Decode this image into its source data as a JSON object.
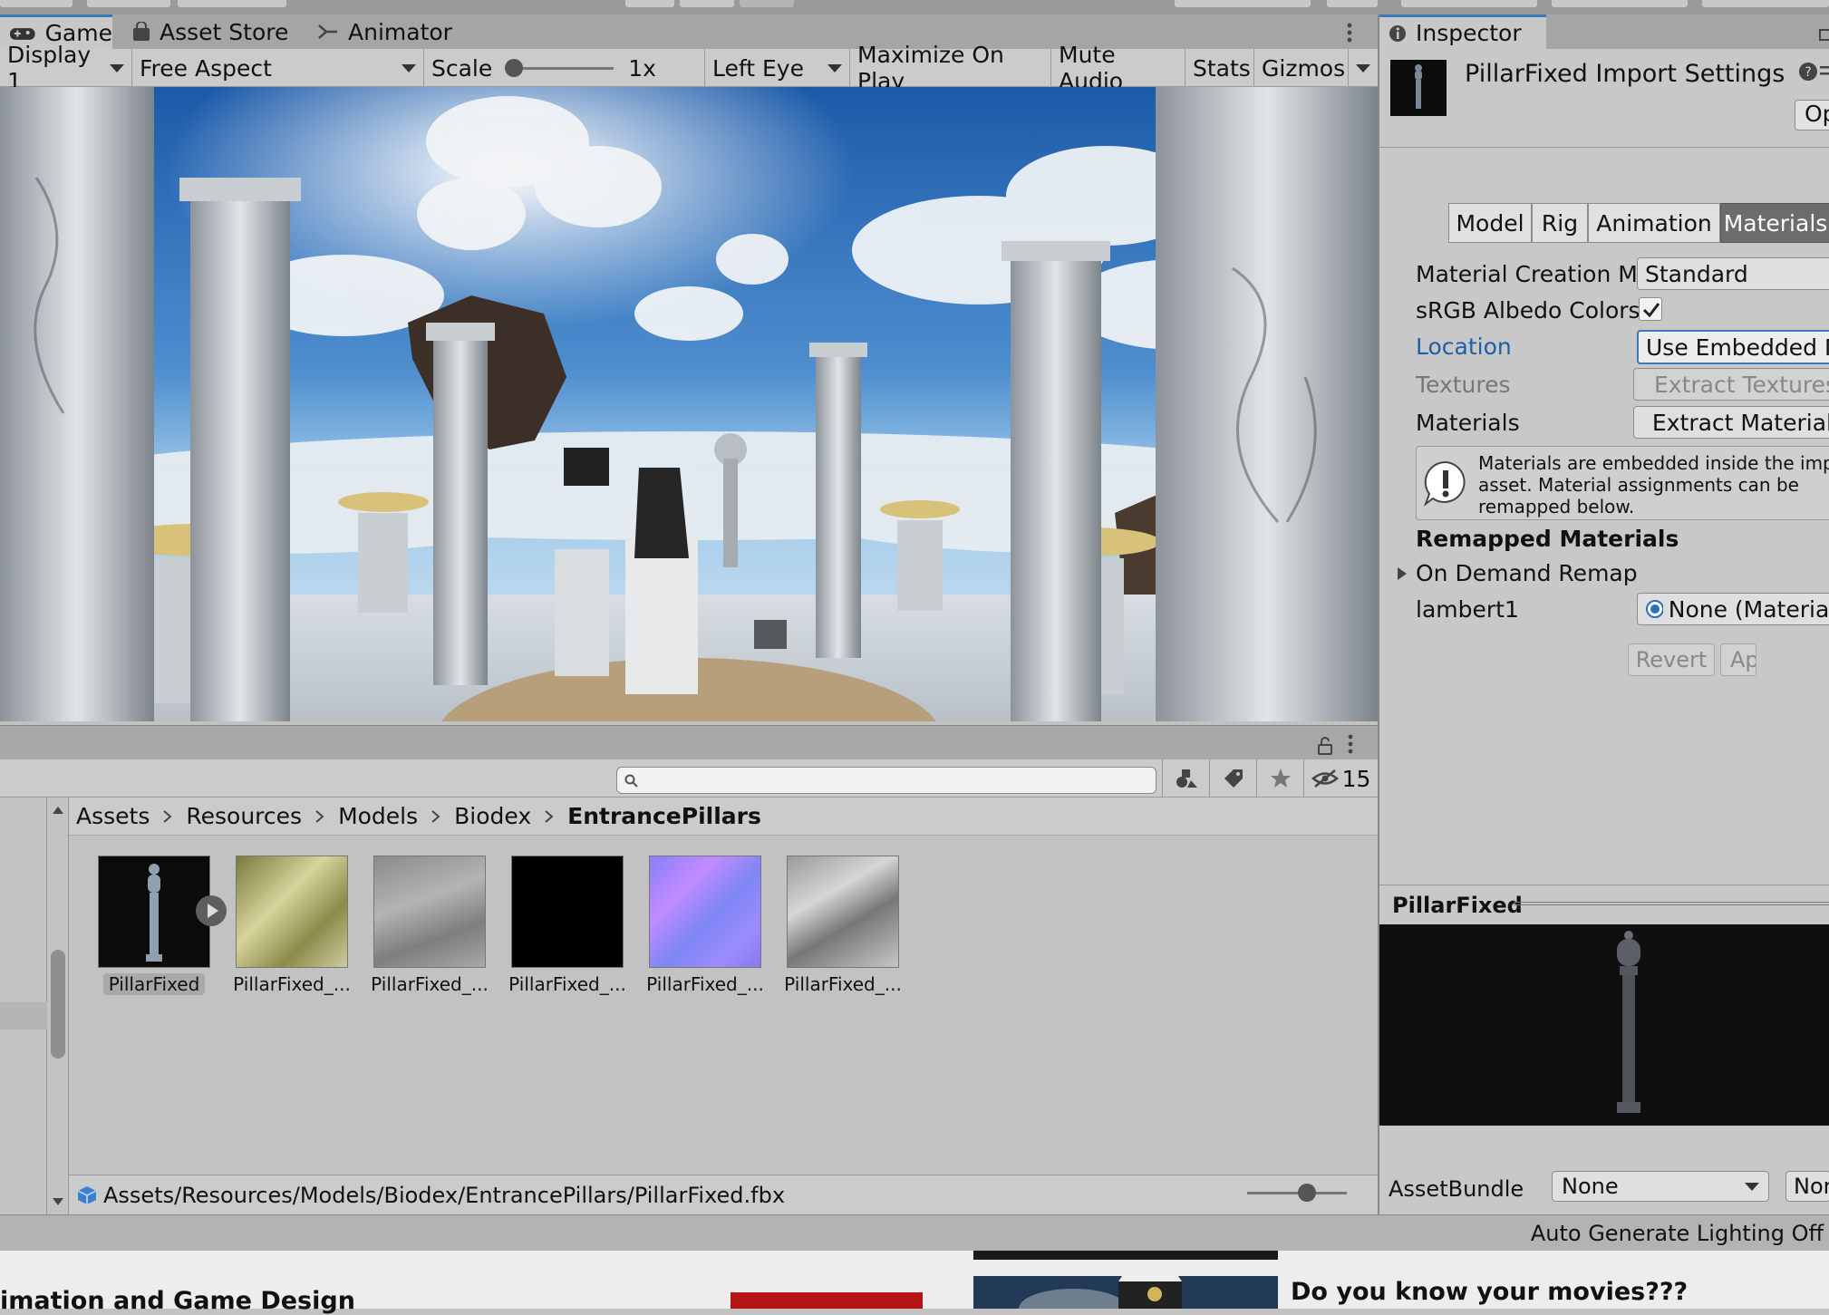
{
  "game_tabs": [
    {
      "label": "Game",
      "icon": "gamepad-icon"
    },
    {
      "label": "Asset Store",
      "icon": "bag-icon"
    },
    {
      "label": "Animator",
      "icon": "animator-icon"
    }
  ],
  "game_toolbar": {
    "display": "Display 1",
    "aspect": "Free Aspect",
    "scale_label": "Scale",
    "scale_value": "1x",
    "eye": "Left Eye",
    "maximize": "Maximize On Play",
    "mute": "Mute Audio",
    "stats": "Stats",
    "gizmos": "Gizmos"
  },
  "project": {
    "search_placeholder": "",
    "hidden_count": "15",
    "breadcrumb": [
      "Assets",
      "Resources",
      "Models",
      "Biodex",
      "EntrancePillars"
    ],
    "assets": [
      {
        "label": "PillarFixed",
        "kind": "model"
      },
      {
        "label": "PillarFixed_...",
        "kind": "albedo"
      },
      {
        "label": "PillarFixed_...",
        "kind": "gray"
      },
      {
        "label": "PillarFixed_...",
        "kind": "black"
      },
      {
        "label": "PillarFixed_...",
        "kind": "normal"
      },
      {
        "label": "PillarFixed_...",
        "kind": "marble"
      }
    ],
    "path": "Assets/Resources/Models/Biodex/EntrancePillars/PillarFixed.fbx"
  },
  "inspector": {
    "tab": "Inspector",
    "title": "PillarFixed Import Settings",
    "open_button": "Op",
    "segments": [
      "Model",
      "Rig",
      "Animation",
      "Materials"
    ],
    "active_segment": "Materials",
    "fields": {
      "material_creation_label": "Material Creation Mo",
      "material_creation_value": "Standard",
      "srgb_label": "sRGB Albedo Colors",
      "srgb_checked": true,
      "location_label": "Location",
      "location_value": "Use Embedded Ma",
      "textures_label": "Textures",
      "textures_button": "Extract Textures.",
      "materials_label": "Materials",
      "materials_button": "Extract Materials"
    },
    "info_text_1": "Materials are embedded inside the impor",
    "info_text_2": "asset. Material assignments can be",
    "info_text_3": "remapped below.",
    "remapped_header": "Remapped Materials",
    "on_demand": "On Demand Remap",
    "lambert_label": "lambert1",
    "lambert_value": "None (Material)",
    "revert": "Revert",
    "apply": "Ap",
    "preview_title": "PillarFixed",
    "assetbundle_label": "AssetBundle",
    "assetbundle_value": "None",
    "assetbundle_variant": "Nor"
  },
  "status": {
    "lighting": "Auto Generate Lighting Off"
  },
  "browser": {
    "left_text": "imation and Game Design",
    "right_text": "Do you know your movies???"
  },
  "colors": {
    "accent": "#3a79bb",
    "selected_tab": "#6c6c6c",
    "link": "#1d5fa8"
  }
}
